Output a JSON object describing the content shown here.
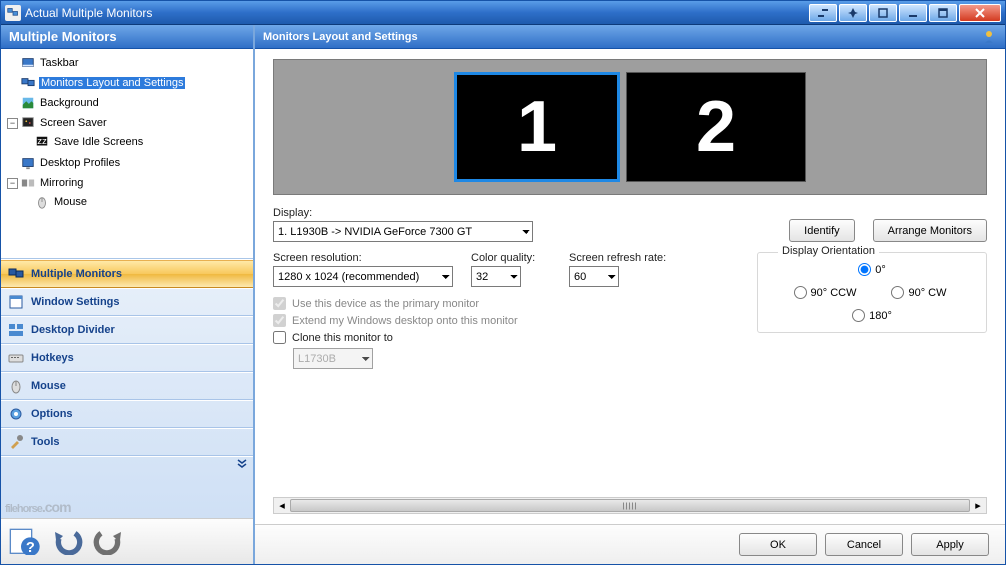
{
  "window": {
    "title": "Actual Multiple Monitors"
  },
  "sidebar": {
    "header": "Multiple Monitors",
    "tree": {
      "taskbar": "Taskbar",
      "layout": "Monitors Layout and Settings",
      "background": "Background",
      "screensaver": "Screen Saver",
      "save_idle": "Save Idle Screens",
      "profiles": "Desktop Profiles",
      "mirroring": "Mirroring",
      "mouse": "Mouse"
    },
    "nav": {
      "multiple": "Multiple Monitors",
      "window": "Window Settings",
      "divider": "Desktop Divider",
      "hotkeys": "Hotkeys",
      "mouse": "Mouse",
      "options": "Options",
      "tools": "Tools"
    }
  },
  "content": {
    "header": "Monitors Layout and Settings",
    "monitor1": "1",
    "monitor2": "2",
    "display_label": "Display:",
    "display_value": "1. L1930B -> NVIDIA GeForce 7300 GT",
    "identify": "Identify",
    "arrange": "Arrange Monitors",
    "resolution_label": "Screen resolution:",
    "resolution_value": "1280 x 1024 (recommended)",
    "color_label": "Color quality:",
    "color_value": "32",
    "refresh_label": "Screen refresh rate:",
    "refresh_value": "60",
    "orientation_label": "Display Orientation",
    "orient_0": "0°",
    "orient_90ccw": "90° CCW",
    "orient_90cw": "90° CW",
    "orient_180": "180°",
    "primary_chk": "Use this device as the primary monitor",
    "extend_chk": "Extend my Windows desktop onto this monitor",
    "clone_chk": "Clone this monitor to",
    "clone_target": "L1730B"
  },
  "footer": {
    "ok": "OK",
    "cancel": "Cancel",
    "apply": "Apply"
  },
  "watermark": {
    "main": "filehorse",
    "suffix": ".com"
  }
}
